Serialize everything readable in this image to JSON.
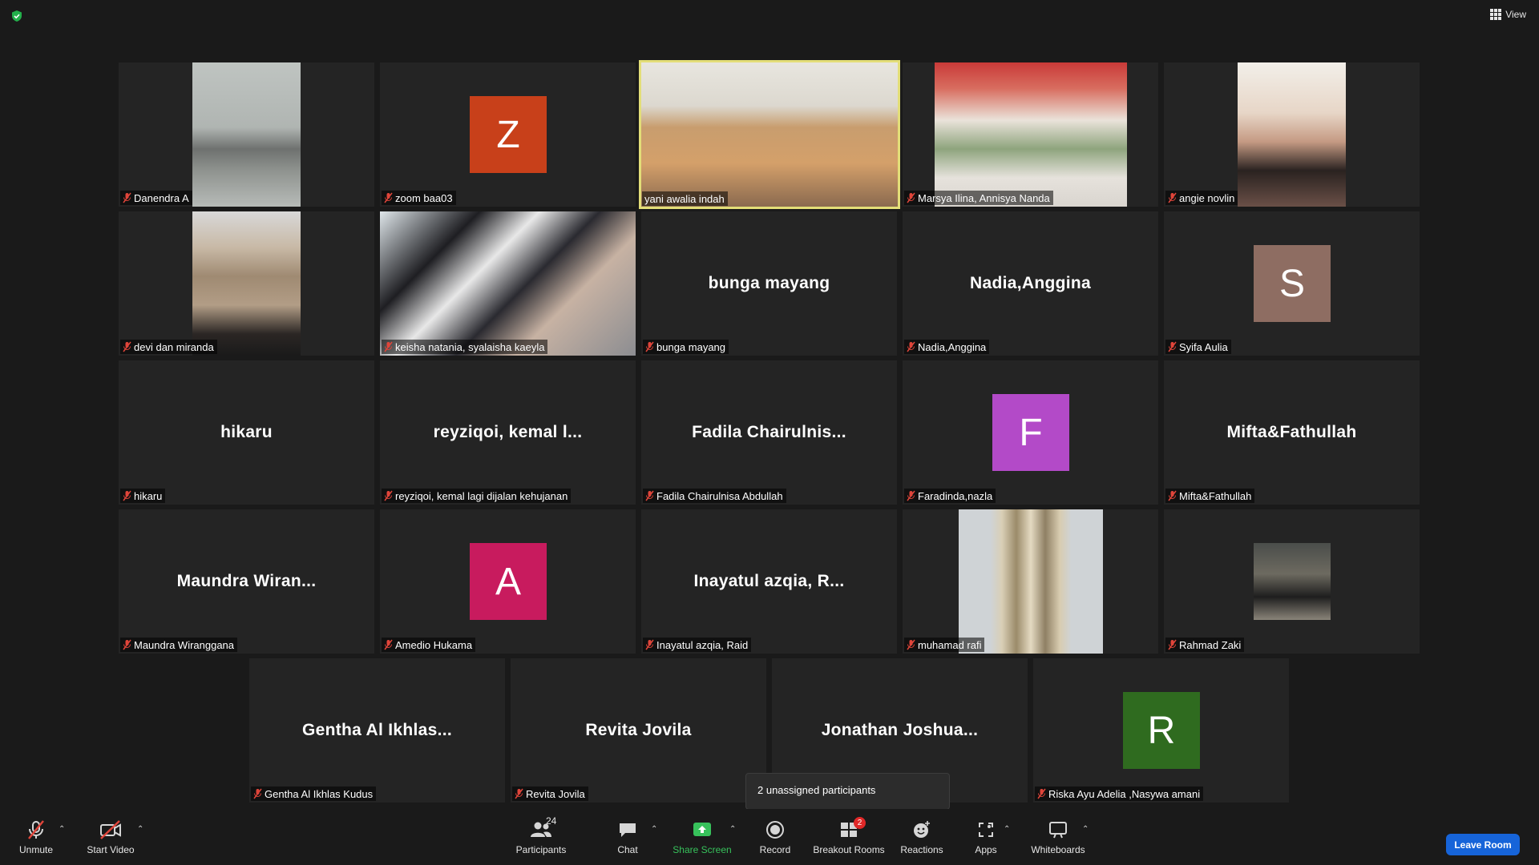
{
  "topbar": {
    "view_label": "View"
  },
  "tiles": [
    {
      "name": "Danendra A"
    },
    {
      "name": "zoom baa03",
      "avatar_letter": "Z",
      "avatar_color": "#c8401a"
    },
    {
      "name": "yani awalia indah"
    },
    {
      "name": "Marsya Ilina, Annisya Nanda"
    },
    {
      "name": "angie novlin"
    },
    {
      "name": "devi dan miranda"
    },
    {
      "name": "keisha natania, syalaisha kaeyla"
    },
    {
      "name": "bunga mayang",
      "display_name": "bunga mayang"
    },
    {
      "name": "Nadia,Anggina",
      "display_name": "Nadia,Anggina"
    },
    {
      "name": "Syifa Aulia",
      "avatar_letter": "S",
      "avatar_color": "#8e6d62"
    },
    {
      "name": "hikaru",
      "display_name": "hikaru"
    },
    {
      "name": "reyziqoi, kemal lagi dijalan kehujanan",
      "display_name": "reyziqoi,  kemal  l..."
    },
    {
      "name": "Fadila Chairulnisa Abdullah",
      "display_name": "Fadila  Chairulnis..."
    },
    {
      "name": "Faradinda,nazla",
      "avatar_letter": "F",
      "avatar_color": "#b34ac8"
    },
    {
      "name": "Mifta&Fathullah",
      "display_name": "Mifta&Fathullah"
    },
    {
      "name": "Maundra Wiranggana",
      "display_name": "Maundra  Wiran..."
    },
    {
      "name": "Amedio Hukama",
      "avatar_letter": "A",
      "avatar_color": "#c81b5e"
    },
    {
      "name": "Inayatul azqia, Raid",
      "display_name": "Inayatul  azqia,  R..."
    },
    {
      "name": "muhamad rafi"
    },
    {
      "name": "Rahmad Zaki"
    },
    {
      "name": "Gentha Al Ikhlas Kudus",
      "display_name": "Gentha  Al  Ikhlas..."
    },
    {
      "name": "Revita Jovila",
      "display_name": "Revita Jovila"
    },
    {
      "name": "Jonathan Joshua...",
      "display_name": "Jonathan  Joshua..."
    },
    {
      "name": "Riska Ayu Adelia ,Nasywa amani",
      "avatar_letter": "R",
      "avatar_color": "#2f6b1f"
    }
  ],
  "tooltip": {
    "text": "2 unassigned participants"
  },
  "toolbar": {
    "unmute": "Unmute",
    "start_video": "Start Video",
    "participants": "Participants",
    "participants_count": "24",
    "chat": "Chat",
    "share_screen": "Share Screen",
    "record": "Record",
    "breakout_rooms": "Breakout Rooms",
    "breakout_badge": "2",
    "reactions": "Reactions",
    "apps": "Apps",
    "whiteboards": "Whiteboards",
    "leave_room": "Leave Room"
  },
  "colors": {
    "active_border": "#e3de78",
    "share_green": "#37c15b",
    "leave_blue": "#1664d9",
    "mic_off_red": "#e0453a"
  }
}
